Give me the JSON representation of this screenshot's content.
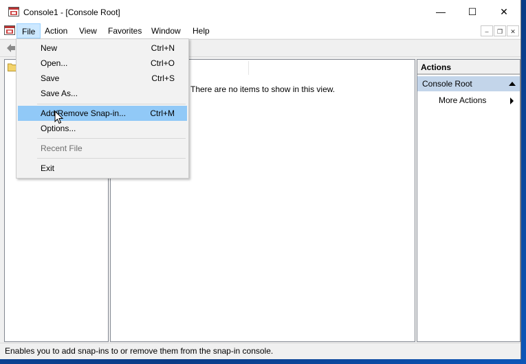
{
  "window": {
    "title": "Console1 - [Console Root]",
    "controls": {
      "minimize": "—",
      "maximize": "☐",
      "close": "✕"
    }
  },
  "menubar": {
    "items": [
      {
        "label": "File",
        "active": true
      },
      {
        "label": "Action"
      },
      {
        "label": "View"
      },
      {
        "label": "Favorites"
      },
      {
        "label": "Window"
      },
      {
        "label": "Help"
      }
    ],
    "mdi_controls": {
      "minimize": "–",
      "restore": "❐",
      "close": "✕"
    }
  },
  "file_menu": {
    "items": [
      {
        "label": "New",
        "shortcut": "Ctrl+N"
      },
      {
        "label": "Open...",
        "shortcut": "Ctrl+O"
      },
      {
        "label": "Save",
        "shortcut": "Ctrl+S"
      },
      {
        "label": "Save As...",
        "shortcut": ""
      },
      {
        "label": "Add/Remove Snap-in...",
        "shortcut": "Ctrl+M",
        "highlighted": true
      },
      {
        "label": "Options...",
        "shortcut": ""
      },
      {
        "label": "Recent File",
        "shortcut": "",
        "disabled": true
      },
      {
        "label": "Exit",
        "shortcut": ""
      }
    ]
  },
  "center_pane": {
    "empty_message": "There are no items to show in this view."
  },
  "actions_pane": {
    "title": "Actions",
    "section": "Console Root",
    "items": [
      {
        "label": "More Actions"
      }
    ]
  },
  "statusbar": {
    "text": "Enables you to add snap-ins to or remove them from the snap-in console."
  },
  "colors": {
    "menu_highlight": "#91c9f7",
    "active_menu_bg": "#cce8ff",
    "actions_section_bg": "#c3d5ea",
    "desktop": "#0b4fa8"
  }
}
